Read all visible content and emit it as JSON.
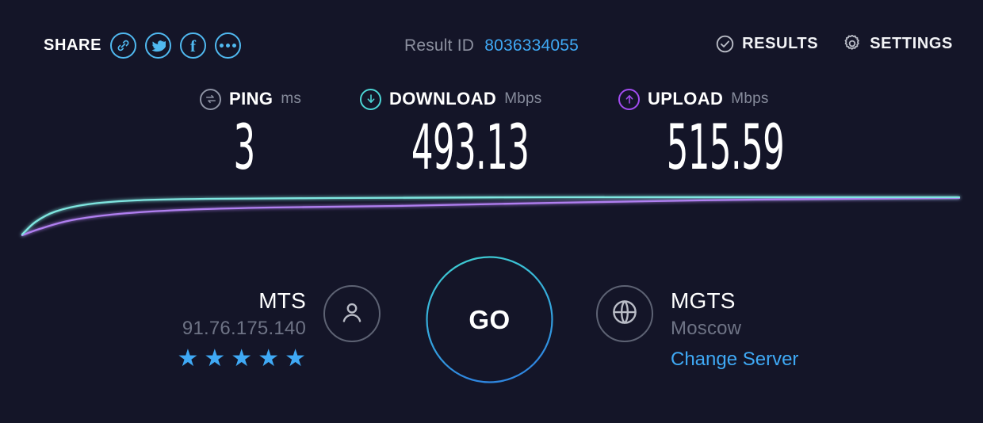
{
  "theme": {
    "background": "#141528",
    "accent_blue": "#3fa9f5",
    "share_blue": "#50b9f0",
    "download_teal": "#4cd4d4",
    "upload_purple": "#a24cf0",
    "muted_text": "#868b9b"
  },
  "topbar": {
    "share_label": "SHARE",
    "share_icons": [
      {
        "name": "link-icon",
        "glyph": "link"
      },
      {
        "name": "twitter-icon",
        "glyph": "twitter"
      },
      {
        "name": "facebook-icon",
        "glyph": "f"
      },
      {
        "name": "more-options-icon",
        "glyph": "ellipsis"
      }
    ],
    "result_id_label": "Result ID",
    "result_id_value": "8036334055",
    "results_label": "RESULTS",
    "results_icon": "check-circle-icon",
    "settings_label": "SETTINGS",
    "settings_icon": "gear-icon"
  },
  "metrics": {
    "ping": {
      "name": "PING",
      "unit": "ms",
      "value": "3",
      "icon": "ping-exchange-icon",
      "color": "#8d92a3"
    },
    "download": {
      "name": "DOWNLOAD",
      "unit": "Mbps",
      "value": "493.13",
      "icon": "arrow-down-circle-icon",
      "color": "#4cd4d4"
    },
    "upload": {
      "name": "UPLOAD",
      "unit": "Mbps",
      "value": "515.59",
      "icon": "arrow-up-circle-icon",
      "color": "#a24cf0"
    }
  },
  "chart_data": {
    "type": "line",
    "title": "",
    "xlabel": "",
    "ylabel": "",
    "grid": false,
    "legend": "none",
    "xlim": [
      0,
      1240
    ],
    "ylim": [
      0,
      80
    ],
    "series": [
      {
        "name": "Download",
        "color": "#7fe6e0",
        "points": [
          [
            28,
            64
          ],
          [
            45,
            48
          ],
          [
            70,
            35
          ],
          [
            110,
            26
          ],
          [
            170,
            21
          ],
          [
            260,
            19
          ],
          [
            420,
            18
          ],
          [
            700,
            17
          ],
          [
            1000,
            17
          ],
          [
            1210,
            17
          ]
        ]
      },
      {
        "name": "Upload",
        "color": "#b07ff0",
        "points": [
          [
            28,
            65
          ],
          [
            50,
            57
          ],
          [
            90,
            46
          ],
          [
            150,
            38
          ],
          [
            230,
            33
          ],
          [
            340,
            30
          ],
          [
            500,
            28
          ],
          [
            700,
            24
          ],
          [
            950,
            20
          ],
          [
            1210,
            18
          ]
        ]
      }
    ]
  },
  "bottom": {
    "client": {
      "name": "MTS",
      "ip": "91.76.175.140",
      "rating": 5,
      "rating_max": 5,
      "star_glyph": "★",
      "icon": "person-icon"
    },
    "server": {
      "name": "MGTS",
      "location": "Moscow",
      "change_server_label": "Change Server",
      "icon": "globe-icon"
    },
    "go_button": {
      "label": "GO",
      "ring_top_color": "#3fd0d0",
      "ring_bottom_color": "#2f87e0"
    }
  }
}
